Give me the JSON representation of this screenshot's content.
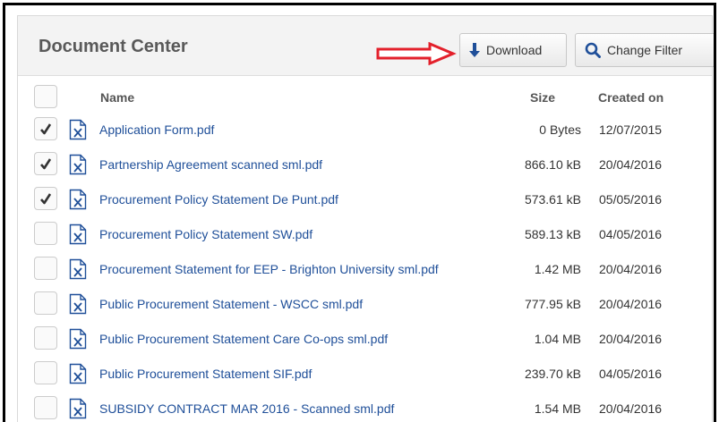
{
  "panel": {
    "title": "Document Center",
    "download_label": "Download",
    "filter_label": "Change Filter"
  },
  "columns": {
    "name": "Name",
    "size": "Size",
    "created": "Created on"
  },
  "colors": {
    "link": "#1f4f99",
    "annotation_arrow": "#e3202b",
    "header_bg": "#f3f3f3"
  },
  "rows": [
    {
      "name": "Application Form.pdf",
      "size": "0 Bytes",
      "created": "12/07/2015",
      "checked": true
    },
    {
      "name": "Partnership Agreement scanned sml.pdf",
      "size": "866.10 kB",
      "created": "20/04/2016",
      "checked": true
    },
    {
      "name": "Procurement Policy Statement De Punt.pdf",
      "size": "573.61 kB",
      "created": "05/05/2016",
      "checked": true
    },
    {
      "name": "Procurement Policy Statement SW.pdf",
      "size": "589.13 kB",
      "created": "04/05/2016",
      "checked": false
    },
    {
      "name": "Procurement Statement for EEP - Brighton University sml.pdf",
      "size": "1.42 MB",
      "created": "20/04/2016",
      "checked": false
    },
    {
      "name": "Public Procurement Statement - WSCC sml.pdf",
      "size": "777.95 kB",
      "created": "20/04/2016",
      "checked": false
    },
    {
      "name": "Public Procurement Statement Care Co-ops sml.pdf",
      "size": "1.04 MB",
      "created": "20/04/2016",
      "checked": false
    },
    {
      "name": "Public Procurement Statement SIF.pdf",
      "size": "239.70 kB",
      "created": "04/05/2016",
      "checked": false
    },
    {
      "name": "SUBSIDY CONTRACT MAR 2016 - Scanned sml.pdf",
      "size": "1.54 MB",
      "created": "20/04/2016",
      "checked": false
    }
  ]
}
